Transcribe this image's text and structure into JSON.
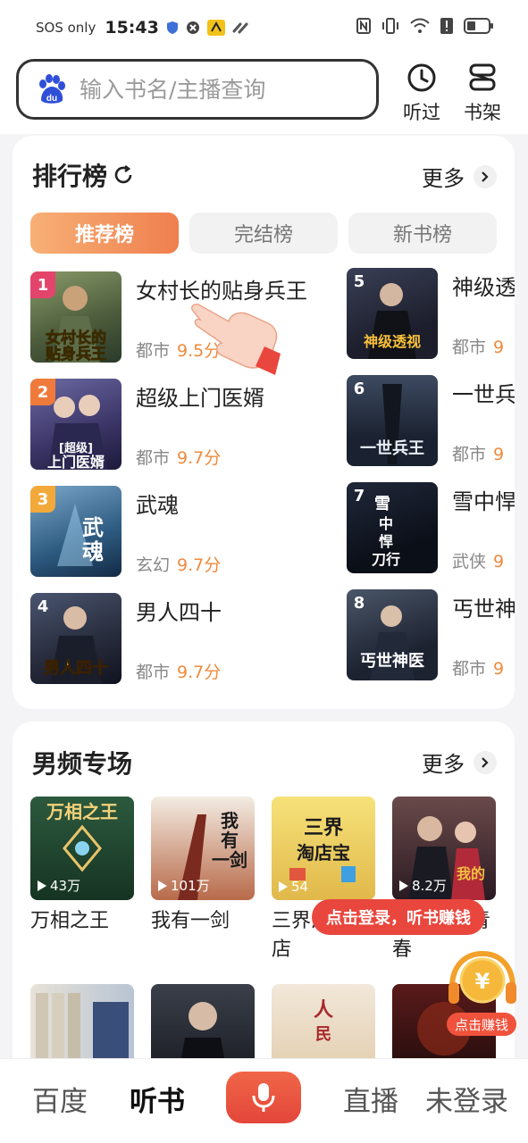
{
  "status_bar": {
    "carrier": "SOS only",
    "time": "15:43"
  },
  "search": {
    "placeholder": "输入书名/主播查询"
  },
  "header_buttons": {
    "history_label": "听过",
    "shelf_label": "书架"
  },
  "ranking": {
    "title": "排行榜",
    "more_label": "更多",
    "tabs": [
      {
        "label": "推荐榜",
        "active": true
      },
      {
        "label": "完结榜",
        "active": false
      },
      {
        "label": "新书榜",
        "active": false
      }
    ],
    "items": [
      {
        "rank": "1",
        "title": "女村长的贴身兵王",
        "category": "都市",
        "score": "9.5分",
        "cover_text": "女村长的贴身兵王"
      },
      {
        "rank": "2",
        "title": "超级上门医婿",
        "category": "都市",
        "score": "9.7分",
        "cover_text": "超级上门医婿"
      },
      {
        "rank": "3",
        "title": "武魂",
        "category": "玄幻",
        "score": "9.7分",
        "cover_text": "武魂"
      },
      {
        "rank": "4",
        "title": "男人四十",
        "category": "都市",
        "score": "9.7分",
        "cover_text": "男人四十"
      },
      {
        "rank": "5",
        "title": "神级透视",
        "category": "都市",
        "score": "9",
        "cover_text": "神级透视"
      },
      {
        "rank": "6",
        "title": "一世兵王",
        "category": "都市",
        "score": "9",
        "cover_text": "一世兵王"
      },
      {
        "rank": "7",
        "title": "雪中悍刀行",
        "category": "武侠",
        "score": "9",
        "cover_text": "雪中悍刀行"
      },
      {
        "rank": "8",
        "title": "丐世神医",
        "category": "都市",
        "score": "9",
        "cover_text": "丐世神医"
      }
    ]
  },
  "male_section": {
    "title": "男频专场",
    "more_label": "更多",
    "books": [
      {
        "title": "万相之王",
        "plays": "43万",
        "cover_text": "万相之王"
      },
      {
        "title": "我有一剑",
        "plays": "101万",
        "cover_text": "我有一剑"
      },
      {
        "title": "三界淘店宝店",
        "plays": "54",
        "cover_text": "三界淘店宝"
      },
      {
        "title": "我的迷乱青春",
        "plays": "8.2万",
        "cover_text": "我的青春"
      }
    ]
  },
  "login_tip": "点击登录，听书赚钱",
  "coin_label": "点击赚钱",
  "bottom_nav": {
    "baidu": "百度",
    "listen": "听书",
    "live": "直播",
    "login": "未登录"
  },
  "colors": {
    "accent": "#ef7f4e",
    "score": "#f08a3c",
    "mic": "#e9463e"
  }
}
